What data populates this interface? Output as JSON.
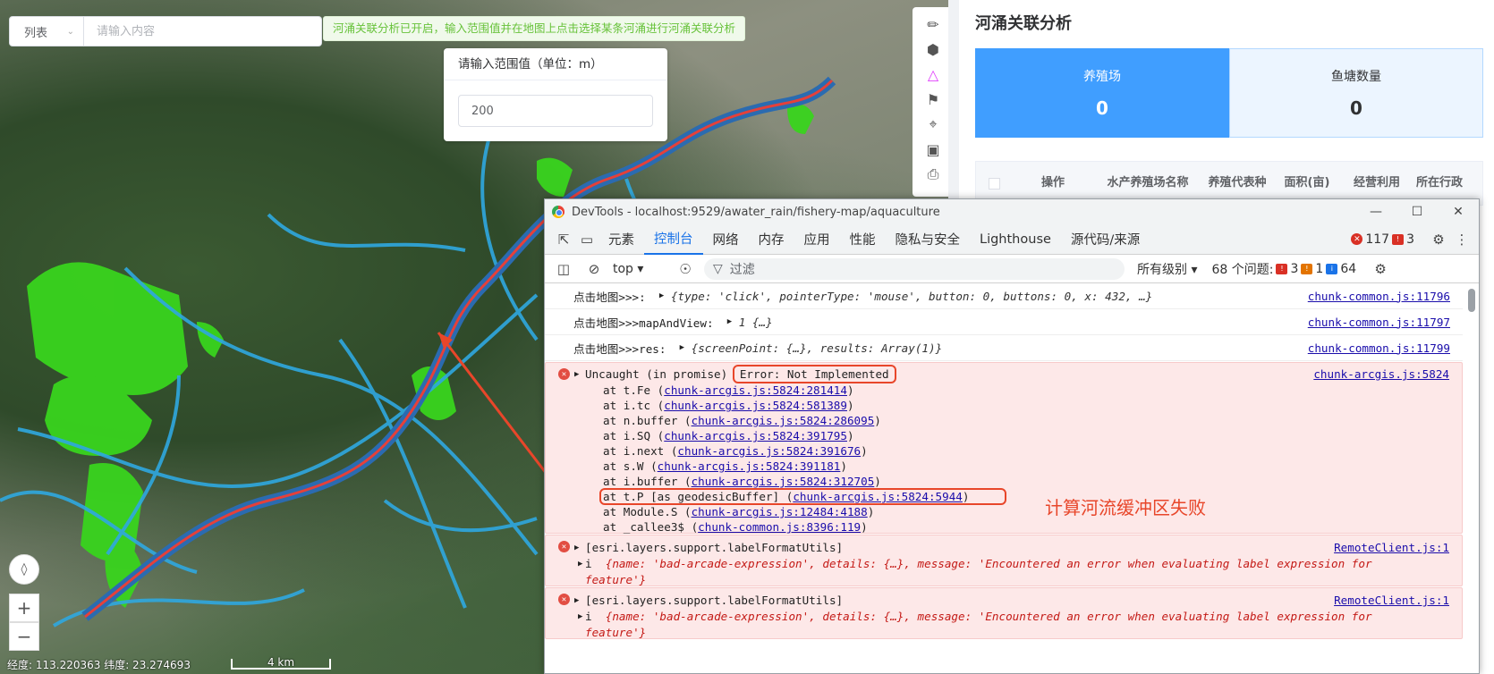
{
  "map": {
    "list_select": "列表",
    "search_placeholder": "请输入内容",
    "notice": "河涌关联分析已开启，输入范围值并在地图上点击选择某条河涌进行河涌关联分析",
    "range_title": "请输入范围值（单位：m）",
    "range_value": "200",
    "coords": "经度: 113.220363 纬度: 23.274693",
    "scale": "4 km",
    "annotation": "计算河流缓冲区失败",
    "tools": [
      "measure-icon",
      "cube-icon",
      "polygon-select-icon",
      "tag-icon",
      "locate-icon",
      "crop-icon",
      "print-icon"
    ]
  },
  "panel": {
    "title": "河涌关联分析",
    "stats": [
      {
        "label": "养殖场",
        "value": "0"
      },
      {
        "label": "鱼塘数量",
        "value": "0"
      }
    ],
    "columns": [
      "操作",
      "水产养殖场名称",
      "养殖代表种",
      "面积(亩)",
      "经营利用",
      "所在行政"
    ]
  },
  "devtools": {
    "title": "DevTools - localhost:9529/awater_rain/fishery-map/aquaculture",
    "tabs": [
      "元素",
      "控制台",
      "网络",
      "内存",
      "应用",
      "性能",
      "隐私与安全",
      "Lighthouse",
      "源代码/来源"
    ],
    "active_tab": "控制台",
    "err_count": "117",
    "warn_count": "3",
    "context": "top",
    "filter_label": "过滤",
    "level": "所有级别",
    "issues_label": "68 个问题:",
    "issue_err": "3",
    "issue_warn": "1",
    "issue_info": "64",
    "logs": [
      {
        "prefix": "点击地图>>>:",
        "body": "{type: 'click', pointerType: 'mouse', button: 0, buttons: 0, x: 432,  …}",
        "src": "chunk-common.js:11796"
      },
      {
        "prefix": "点击地图>>>mapAndView:",
        "body": "1  {…}",
        "src": "chunk-common.js:11797"
      },
      {
        "prefix": "点击地图>>>res:",
        "body": "{screenPoint: {…}, results: Array(1)}",
        "src": "chunk-common.js:11799"
      }
    ],
    "error": {
      "head": "Uncaught (in promise)",
      "msg": "Error: Not Implemented",
      "src": "chunk-arcgis.js:5824",
      "stack": [
        {
          "fn": "at t.Fe (",
          "link": "chunk-arcgis.js:5824:281414",
          "end": ")"
        },
        {
          "fn": "at i.tc (",
          "link": "chunk-arcgis.js:5824:581389",
          "end": ")"
        },
        {
          "fn": "at n.buffer (",
          "link": "chunk-arcgis.js:5824:286095",
          "end": ")"
        },
        {
          "fn": "at i.SQ (",
          "link": "chunk-arcgis.js:5824:391795",
          "end": ")"
        },
        {
          "fn": "at i.next (",
          "link": "chunk-arcgis.js:5824:391676",
          "end": ")"
        },
        {
          "fn": "at s.W (",
          "link": "chunk-arcgis.js:5824:391181",
          "end": ")"
        },
        {
          "fn": "at i.buffer (",
          "link": "chunk-arcgis.js:5824:312705",
          "end": ")"
        },
        {
          "fn": "at t.P [as geodesicBuffer] (",
          "link": "chunk-arcgis.js:5824:5944",
          "end": ")"
        },
        {
          "fn": "at Module.S (",
          "link": "chunk-arcgis.js:12484:4188",
          "end": ")"
        },
        {
          "fn": "at _callee3$ (",
          "link": "chunk-common.js:8396:119",
          "end": ")"
        }
      ]
    },
    "label_errors": [
      {
        "head": "[esri.layers.support.labelFormatUtils]",
        "src": "RemoteClient.js:1",
        "line1": "{name: 'bad-arcade-expression', details: {…}, message: 'Encountered an error when evaluating label expression for",
        "line2": "feature'}"
      },
      {
        "head": "[esri.layers.support.labelFormatUtils]",
        "src": "RemoteClient.js:1",
        "line1": "{name: 'bad-arcade-expression', details: {…}, message: 'Encountered an error when evaluating label expression for",
        "line2": "feature'}"
      }
    ]
  }
}
